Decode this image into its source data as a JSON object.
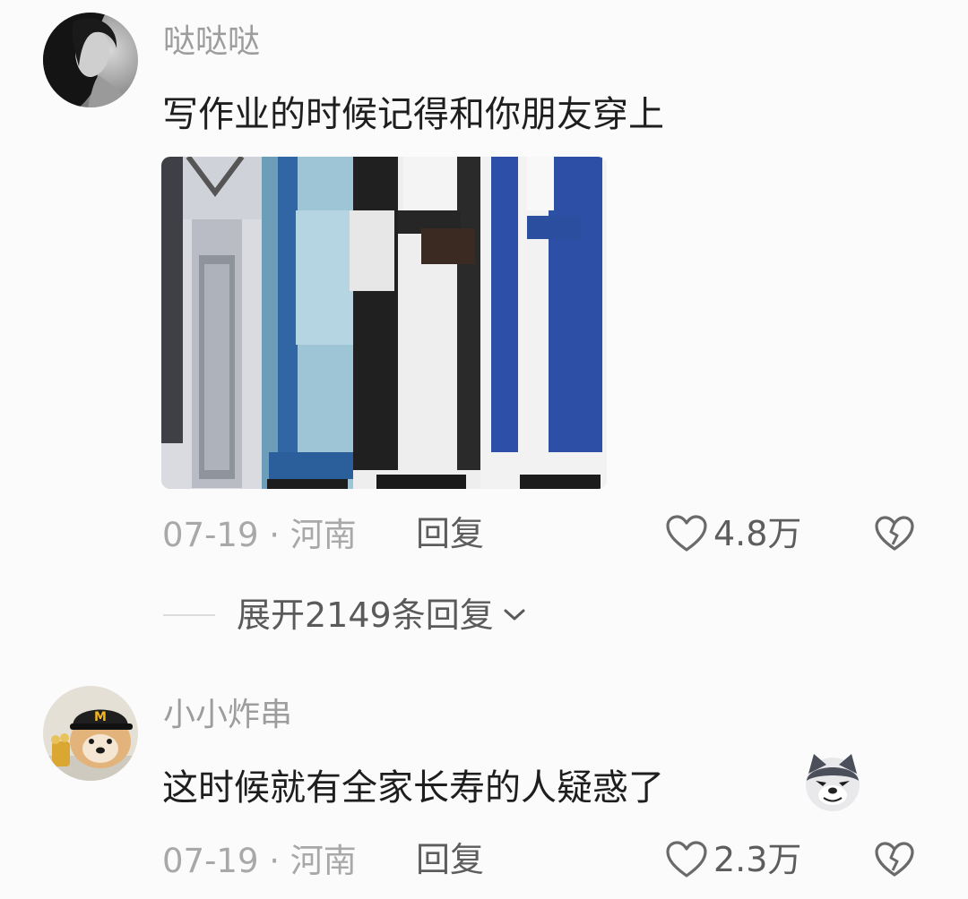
{
  "comments": [
    {
      "username": "哒哒哒",
      "text": "写作业的时候记得和你朋友穿上",
      "date": "07-19",
      "separator": "·",
      "location": "河南",
      "reply_label": "回复",
      "likes": "4.8万",
      "expand_label": "展开2149条回复"
    },
    {
      "username": "小小炸串",
      "text": "这时候就有全家长寿的人疑惑了",
      "date": "07-19",
      "separator": "·",
      "location": "河南",
      "reply_label": "回复",
      "likes": "2.3万"
    }
  ],
  "icons": {
    "like": "heart-outline-icon",
    "dislike": "broken-heart-icon",
    "expand": "chevron-down-icon",
    "emoji": "doge-emoji-icon"
  },
  "colors": {
    "background": "#fbfbfb",
    "username": "#9d9d9d",
    "text": "#1e1e1e",
    "meta": "#a8a8a8",
    "action": "#5d5d5d"
  }
}
